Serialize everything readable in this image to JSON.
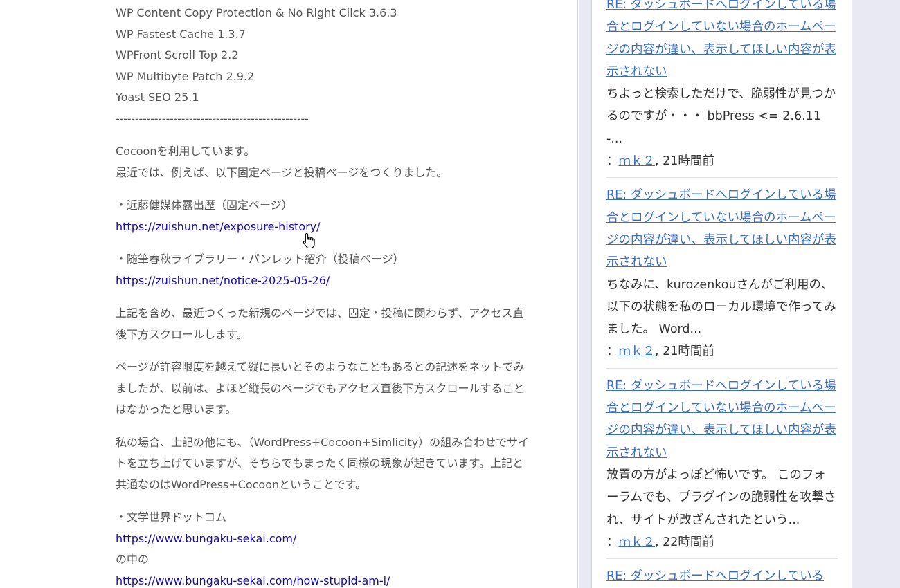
{
  "plugins": [
    "WP Content Copy Protection & No Right Click 3.6.3",
    "WP Fastest Cache 1.3.7",
    "WPFront Scroll Top 2.2",
    "WP Multibyte Patch 2.9.2",
    "Yoast SEO 25.1"
  ],
  "divider": "--------------------------------------------------",
  "intro_1": "Cocoonを利用しています。",
  "intro_2": "最近では、例えば、以下固定ページと投稿ページをつくりました。",
  "item1_label": "・近藤健媒体露出歴（固定ページ）",
  "item1_link": "https://zuishun.net/exposure-history/",
  "item2_label": "・随筆春秋ライブラリー・パンレット紹介（投稿ページ）",
  "item2_link": "https://zuishun.net/notice-2025-05-26/",
  "para1": "上記を含め、最近つくった新規のページでは、固定・投稿に関わらず、アクセス直後下方スクロールします。",
  "para2": "ページが許容限度を越えて縦に長いとそのようなこともあるとの記述をネットでみましたが、以前は、よほど縦長のページでもアクセス直後下方スクロールすることはなかったと思います。",
  "para3": "私の場合、上記の他にも、（WordPress+Cocoon+Simlicity）の組み合わせでサイトを立ち上げていますが、そちらでもまったく同様の現象が起きています。上記と共通なのはWordPress+Cocoonということです。",
  "item3_label": "・文学世界ドットコム",
  "item3_link": "https://www.bungaku-sekai.com/",
  "item3_mid": "の中の",
  "item3_link2": "https://www.bungaku-sekai.com/how-stupid-am-i/",
  "sidebar": {
    "items": [
      {
        "title": "RE: ダッシュボードへログインしている場合とログインしていない場合のホームページの内容が違い、表示してほしい内容が表示されない",
        "excerpt": "ちよっと検索しただけで、脆弱性が見つかるのですが・・・ bbPress <= 2.6.11 -...",
        "meta_prefix": "：",
        "author": "ｍｋ２",
        "time": ", 21時間前"
      },
      {
        "title": "RE: ダッシュボードへログインしている場合とログインしていない場合のホームページの内容が違い、表示してほしい内容が表示されない",
        "excerpt": "ちなみに、kurozenkouさんがご利用の、以下の状態を私のローカル環境で作ってみました。 Word...",
        "meta_prefix": "：",
        "author": "ｍｋ２",
        "time": ", 21時間前"
      },
      {
        "title": "RE: ダッシュボードへログインしている場合とログインしていない場合のホームページの内容が違い、表示してほしい内容が表示されない",
        "excerpt": "放置の方がよっぽど怖いです。 このフォーラムでも、プラグインの脆弱性を攻撃され、サイトが改ざんされたという...",
        "meta_prefix": "：",
        "author": "ｍｋ２",
        "time": ", 22時間前"
      },
      {
        "title": "RE: ダッシュボードへログインしている",
        "excerpt": "",
        "meta_prefix": "",
        "author": "",
        "time": ""
      }
    ]
  }
}
